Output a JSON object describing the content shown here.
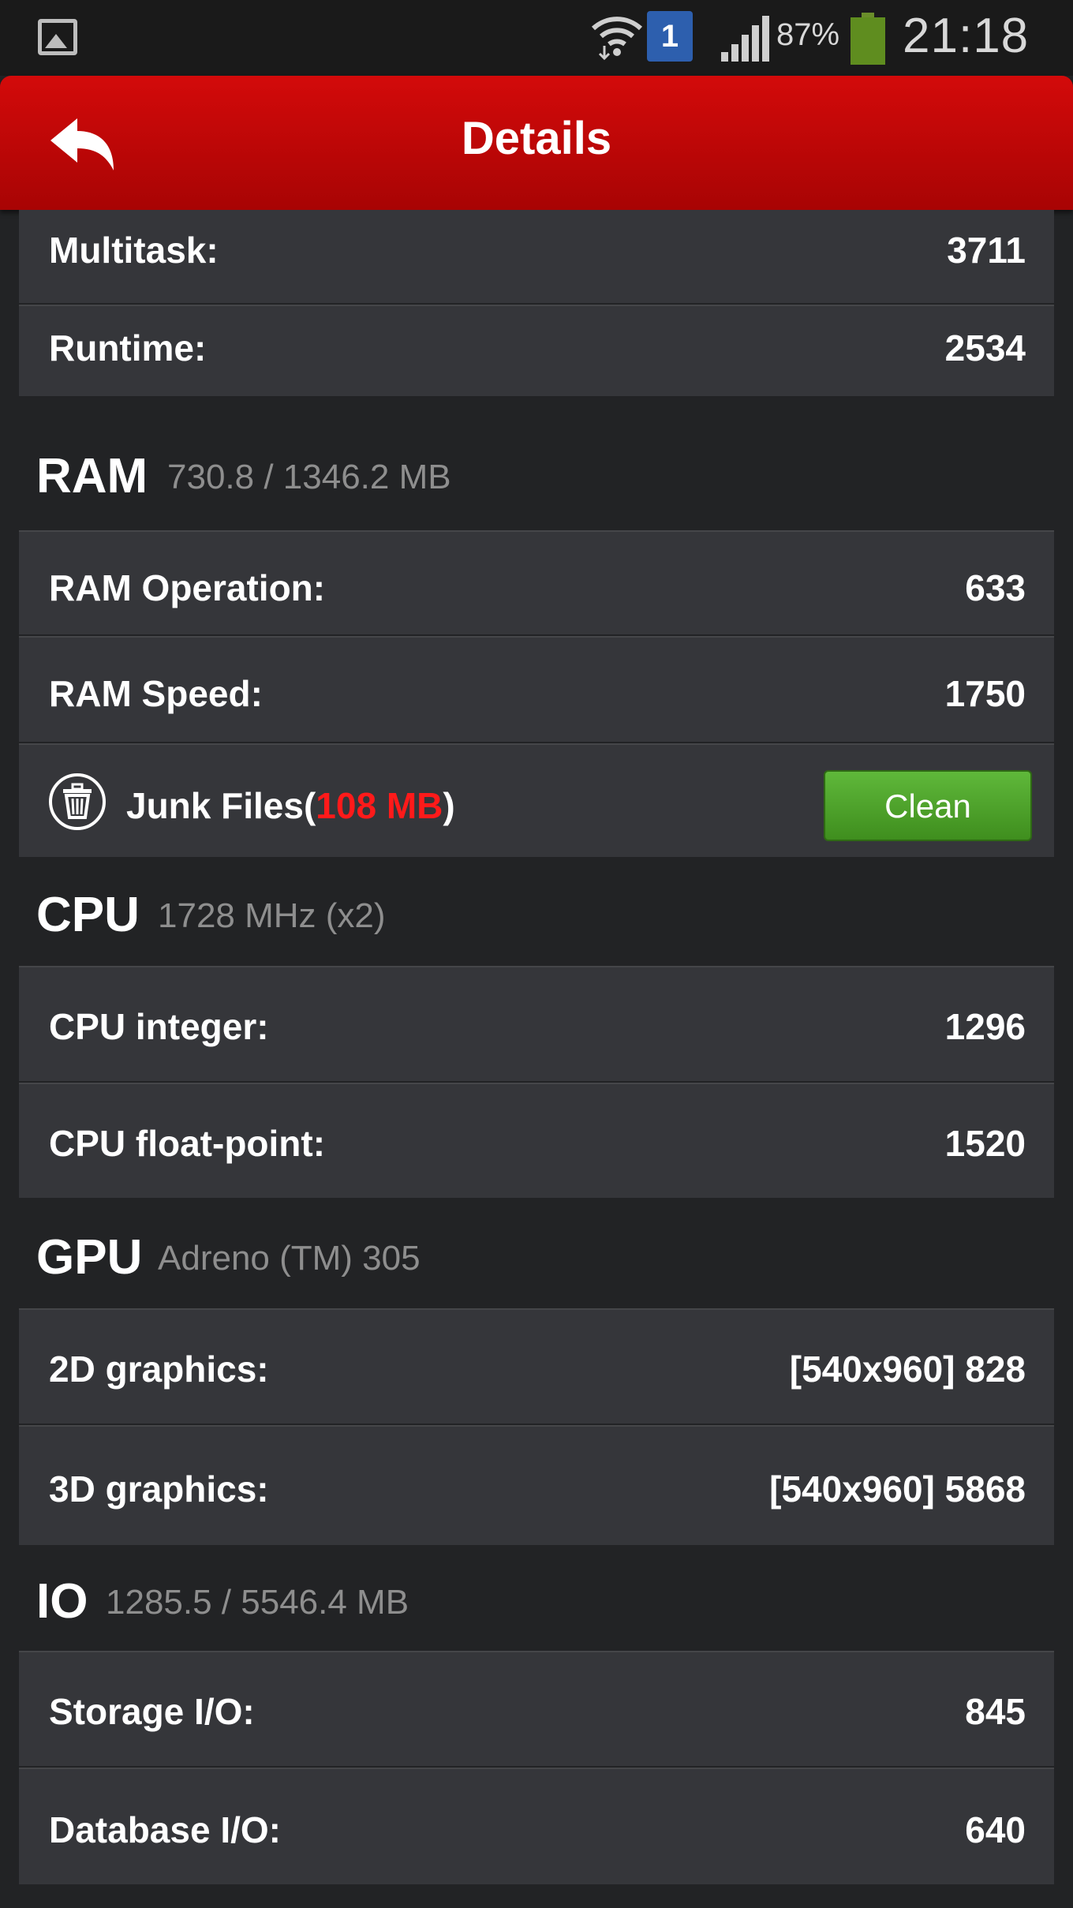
{
  "status_bar": {
    "sim_slot": "1",
    "battery_percent": "87%",
    "clock": "21:18",
    "icons": [
      "gallery-icon",
      "wifi-icon",
      "sim-icon",
      "signal-icon",
      "battery-icon"
    ]
  },
  "header": {
    "title": "Details",
    "back_icon": "back-arrow-icon"
  },
  "top_rows": [
    {
      "label": "Multitask:",
      "value": "3711"
    },
    {
      "label": "Runtime:",
      "value": "2534"
    }
  ],
  "ram": {
    "title": "RAM",
    "subtitle": "730.8 / 1346.2 MB",
    "rows": [
      {
        "label": "RAM Operation:",
        "value": "633"
      },
      {
        "label": "RAM Speed:",
        "value": "1750"
      }
    ],
    "junk": {
      "label_prefix": "Junk Files(",
      "size": "108 MB",
      "label_suffix": ")",
      "button": "Clean",
      "icon": "trash-icon"
    }
  },
  "cpu": {
    "title": "CPU",
    "subtitle": "1728 MHz (x2)",
    "rows": [
      {
        "label": "CPU integer:",
        "value": "1296"
      },
      {
        "label": "CPU float-point:",
        "value": "1520"
      }
    ]
  },
  "gpu": {
    "title": "GPU",
    "subtitle": "Adreno (TM) 305",
    "rows": [
      {
        "label": "2D graphics:",
        "value": "[540x960] 828"
      },
      {
        "label": "3D graphics:",
        "value": "[540x960] 5868"
      }
    ]
  },
  "io": {
    "title": "IO",
    "subtitle": "1285.5 / 5546.4 MB",
    "rows": [
      {
        "label": "Storage I/O:",
        "value": "845"
      },
      {
        "label": "Database I/O:",
        "value": "640"
      }
    ]
  },
  "colors": {
    "header_red": "#c00606",
    "card_bg": "#35363a",
    "junk_size_red": "#ff1a1a",
    "clean_green": "#4fa52c"
  }
}
